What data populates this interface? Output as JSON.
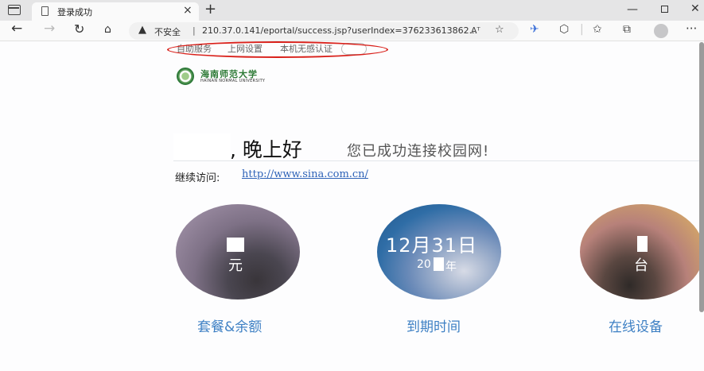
{
  "browser": {
    "tab_title": "登录成功",
    "tab_close": "×",
    "new_tab": "+",
    "window_min": "—",
    "window_close": "✕",
    "nav_back": "←",
    "nav_forward": "→",
    "nav_reload": "↻",
    "nav_home": "⌂",
    "warning_glyph": "▲",
    "insecure_label": "不安全",
    "address_separator": "|",
    "url": "210.37.0.141/eportal/success.jsp?userIndex=376233613862...",
    "read_aloud": "Aᵀ",
    "more": "···"
  },
  "topnav": {
    "self_service": "自助服务",
    "network_settings": "上网设置",
    "no_sense_auth": "本机无感认证"
  },
  "logo": {
    "name": "海南师范大学",
    "name_en": "HAINAN NORMAL UNIVERSITY"
  },
  "welcome": {
    "greeting": ", 晚上好",
    "connected": "您已成功连接校园网!",
    "continue_label": "继续访问:",
    "continue_link": "http://www.sina.com.cn/"
  },
  "stats": {
    "package": {
      "unit": "元",
      "caption": "套餐&余额"
    },
    "expiry": {
      "date": "12月31日",
      "year_prefix": "20",
      "year_suffix": "年",
      "caption": "到期时间"
    },
    "devices": {
      "unit": "台",
      "caption": "在线设备"
    }
  },
  "colors": {
    "annotation": "#d9201a",
    "link": "#2e63b8",
    "caption": "#3e80c4",
    "brand_green": "#2d7a36"
  }
}
